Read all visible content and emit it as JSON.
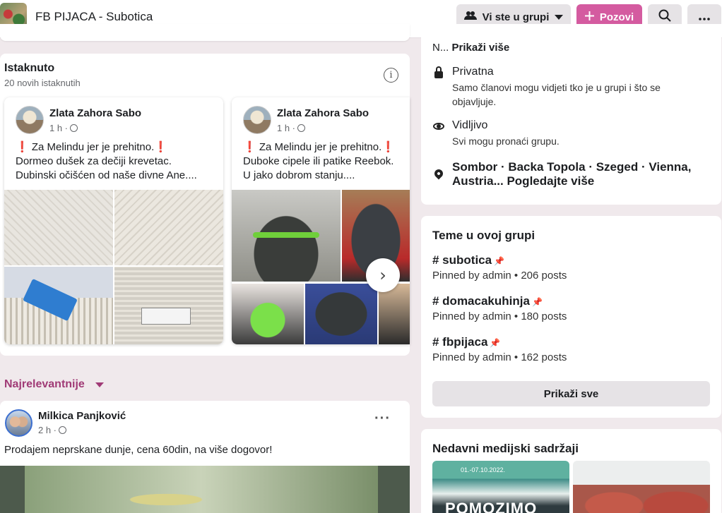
{
  "header": {
    "group_name": "FB PIJACA - Subotica",
    "member_button": "Vi ste u grupi",
    "invite_button": "Pozovi"
  },
  "featured": {
    "title": "Istaknuto",
    "subtitle": "20 novih istaknutih",
    "posts": [
      {
        "author": "Zlata Zahora Sabo",
        "time": "1 h ·",
        "line1": "Za Melindu jer je prehitno.",
        "line2": "Dormeo dušek za dečiji krevetac.",
        "line3": "Dubinski očišćen od naše divne Ane...."
      },
      {
        "author": "Zlata Zahora Sabo",
        "time": "1 h ·",
        "line1": "Za Melindu jer je prehitno.",
        "line2": "Duboke cipele ili patike Reebok.",
        "line3": "U jako dobrom stanju...."
      }
    ]
  },
  "feed": {
    "sort_label": "Najrelevantnije",
    "post": {
      "author": "Milkica Panjković",
      "time": "2 h ·",
      "text": "Prodajem neprskane dunje, cena 60din, na više dogovor!"
    }
  },
  "about": {
    "description_prefix": "N...",
    "show_more": "Prikaži više",
    "privacy_title": "Privatna",
    "privacy_desc": "Samo članovi mogu vidjeti tko je u grupi i što se objavljuje.",
    "visibility_title": "Vidljivo",
    "visibility_desc": "Svi mogu pronaći grupu.",
    "location": "Sombor · Backa Topola · Szeged · Vienna, Austria... Pogledajte više"
  },
  "topics": {
    "title": "Teme u ovoj grupi",
    "items": [
      {
        "name": "# subotica",
        "meta": "Pinned by admin • 206 posts"
      },
      {
        "name": "# domacakuhinja",
        "meta": "Pinned by admin • 180 posts"
      },
      {
        "name": "# fbpijaca",
        "meta": "Pinned by admin • 162 posts"
      }
    ],
    "show_all": "Prikaži sve"
  },
  "media": {
    "title": "Nedavni medijski sadržaji",
    "thumb1_date": "01.-07.10.2022.",
    "thumb1_text": "POMOZIMO"
  },
  "colors": {
    "accent": "#d45ba0",
    "sort_label": "#a03a76",
    "background": "#f0e9ec"
  }
}
